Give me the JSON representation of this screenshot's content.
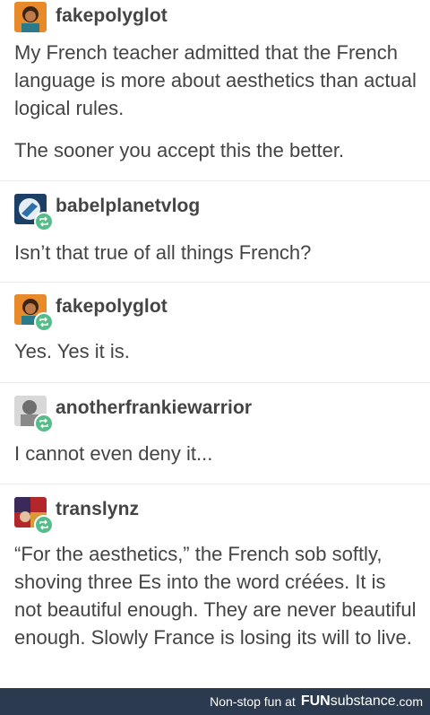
{
  "posts": [
    {
      "username": "fakepolyglot",
      "paragraphs": [
        "My French teacher admitted that the French language is more about aesthetics than actual logical rules.",
        "The sooner you accept this the better."
      ]
    },
    {
      "username": "babelplanetvlog",
      "text": "Isn’t that true of all things French?"
    },
    {
      "username": "fakepolyglot",
      "text": "Yes. Yes it is."
    },
    {
      "username": "anotherfrankiewarrior",
      "text": "I cannot even deny it..."
    },
    {
      "username": "translynz",
      "text": "“For the aesthetics,” the French sob softly, shoving three Es into the word créées. It is not beautiful enough. They are never beautiful enough. Slowly France is losing its will to live."
    }
  ],
  "icons": {
    "reblog": "reblog-icon",
    "avatars": [
      "avatar-orange-character",
      "avatar-blue-planet",
      "avatar-orange-character",
      "avatar-grey-portrait",
      "avatar-red-collage"
    ]
  },
  "footer": {
    "lead": "Non-stop fun at",
    "brand_main": "FUN",
    "brand_sub": "substance",
    "domain": ".com"
  },
  "colors": {
    "text": "#444444",
    "reblog_badge": "#56bc8a",
    "footer_bg": "#2b3a4e"
  }
}
